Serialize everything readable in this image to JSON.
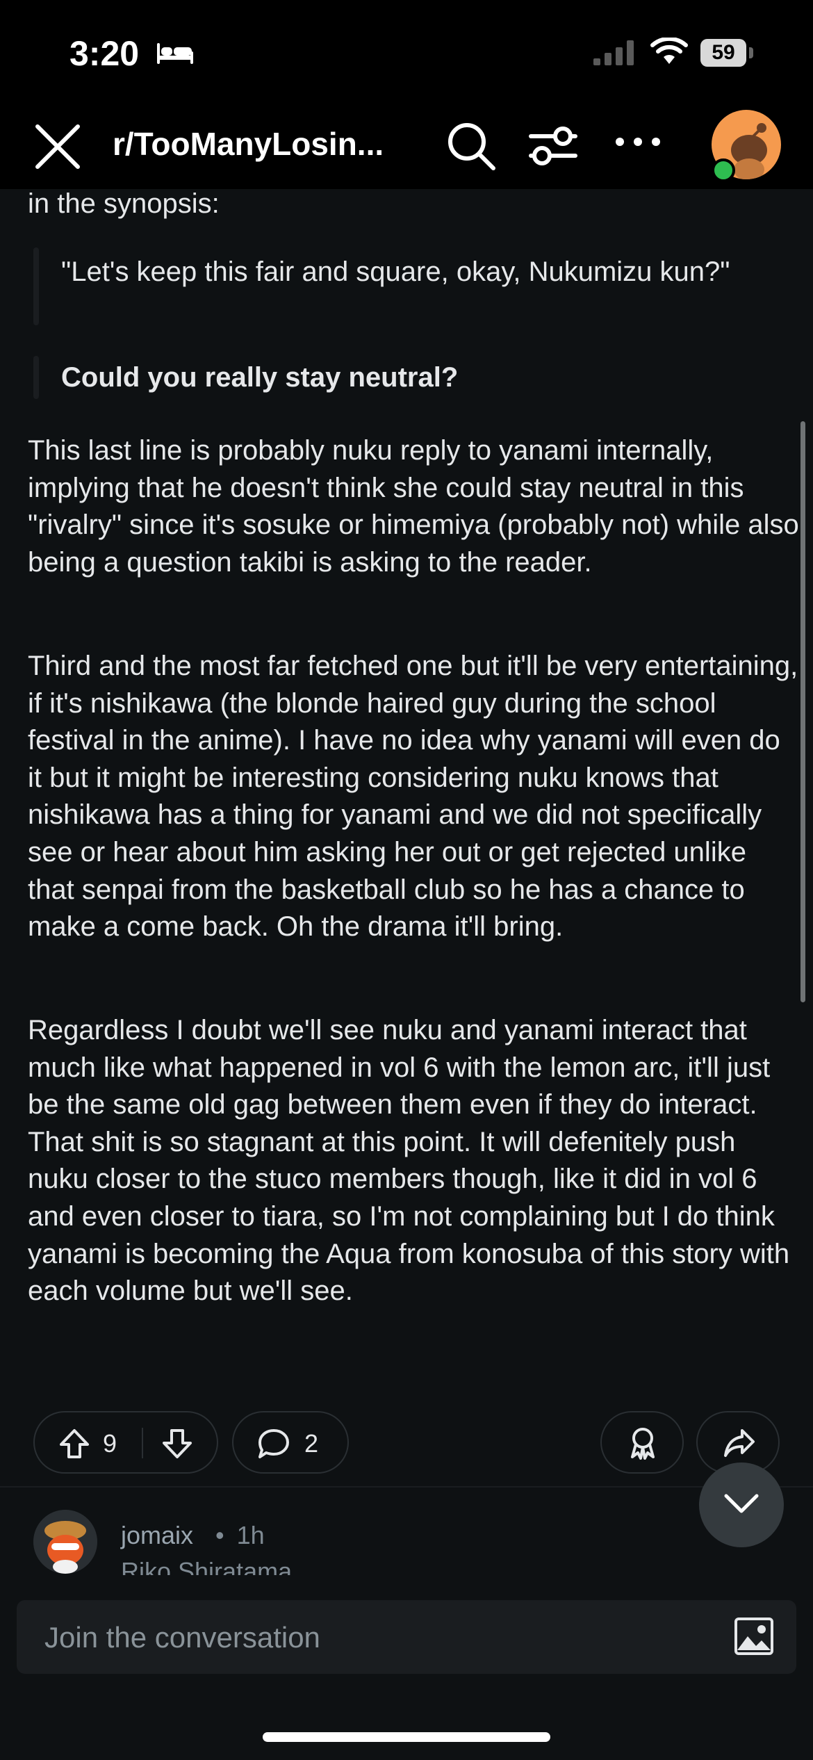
{
  "status": {
    "time": "3:20",
    "battery": "59"
  },
  "nav": {
    "title": "r/TooManyLosin..."
  },
  "post": {
    "partial_line": "in the synopsis:",
    "quote1": "\"Let's keep this fair and square, okay, Nukumizu kun?\"",
    "quote2": "Could you really stay neutral?",
    "paragraphs": [
      "This last line is probably nuku reply to yanami internally, implying that he doesn't think she could stay neutral in this \"rivalry\" since it's sosuke or himemiya (probably not) while also being a question takibi is asking to the reader.",
      "Third and the most far fetched one but it'll be very entertaining, if it's nishikawa (the blonde haired guy during the school festival in the anime). I have no idea why yanami will even do it but it might be interesting considering nuku knows that nishikawa has a thing for yanami and we did not specifically see or hear about him asking her out or get rejected unlike that senpai from the basketball club so he has a chance to make a come back. Oh the drama it'll bring.",
      "Regardless I doubt we'll see nuku and yanami interact that much like what happened in vol 6 with the lemon arc, it'll just be the same old gag between them even if they do interact. That shit is so stagnant at this point. It will defenitely push nuku closer to the stuco members though, like it did in vol 6 and even closer to tiara, so I'm not complaining but I do think yanami is becoming the Aqua from konosuba of this story with each volume but we'll see."
    ]
  },
  "actions": {
    "votes": "9",
    "comments": "2"
  },
  "next_comment": {
    "username": "jomaix",
    "separator": "•",
    "age": "1h",
    "flair": "Riko Shiratama"
  },
  "compose": {
    "placeholder": "Join the conversation"
  },
  "colors": {
    "background": "#0e1113",
    "text": "#e6e8ea",
    "muted": "#8a9399",
    "avatar_orange": "#f59a4e",
    "online_green": "#2ebd50"
  }
}
